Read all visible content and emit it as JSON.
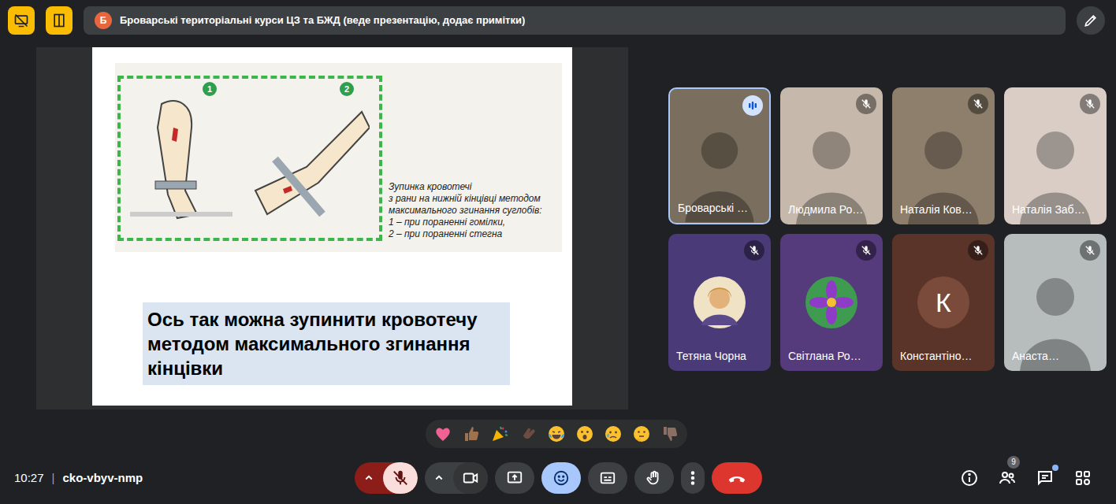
{
  "presenter": {
    "initial": "Б",
    "text": "Броварські територіальні курси ЦЗ та БЖД (веде презентацію, додає примітки)"
  },
  "slide": {
    "figure_numbers": [
      "1",
      "2"
    ],
    "caption_lines": [
      "Зупинка кровотечі",
      "з рани на нижній кінцівці методом",
      "максимального згинання суглобів:",
      "1 – при пораненні гомілки,",
      "2 – при пораненні стегна"
    ],
    "body": "Ось так можна зупинити кровотечу методом максимального згинання кінцівки"
  },
  "participants": [
    {
      "name": "Броварські …",
      "kind": "video",
      "muted": false,
      "speaking": true,
      "color": "#7a6e5e"
    },
    {
      "name": "Людмила Ро…",
      "kind": "video",
      "muted": true,
      "speaking": false,
      "color": "#c6b9ab"
    },
    {
      "name": "Наталія Ков…",
      "kind": "video",
      "muted": true,
      "speaking": false,
      "color": "#8e7f6c"
    },
    {
      "name": "Наталія Заб…",
      "kind": "video",
      "muted": true,
      "speaking": false,
      "color": "#d9cdc6"
    },
    {
      "name": "Тетяна Чорна",
      "kind": "photo-avatar",
      "muted": true,
      "speaking": false,
      "color": "#4a3a78"
    },
    {
      "name": "Світлана Ро…",
      "kind": "flower-avatar",
      "muted": true,
      "speaking": false,
      "color": "#553a7c"
    },
    {
      "name": "Константіно…",
      "kind": "letter-avatar",
      "initial": "К",
      "muted": true,
      "speaking": false,
      "color": "#5a3428"
    },
    {
      "name": "Анаста…",
      "kind": "video",
      "muted": true,
      "speaking": false,
      "color": "#b7bcbc"
    }
  ],
  "footer": {
    "time": "10:27",
    "separator": "|",
    "meeting_code": "cko-vbyv-nmp"
  },
  "controls": {
    "mic_muted": true,
    "camera_off": false,
    "reactions_open": true
  },
  "side": {
    "people_count": "9",
    "chat_unread": true
  }
}
